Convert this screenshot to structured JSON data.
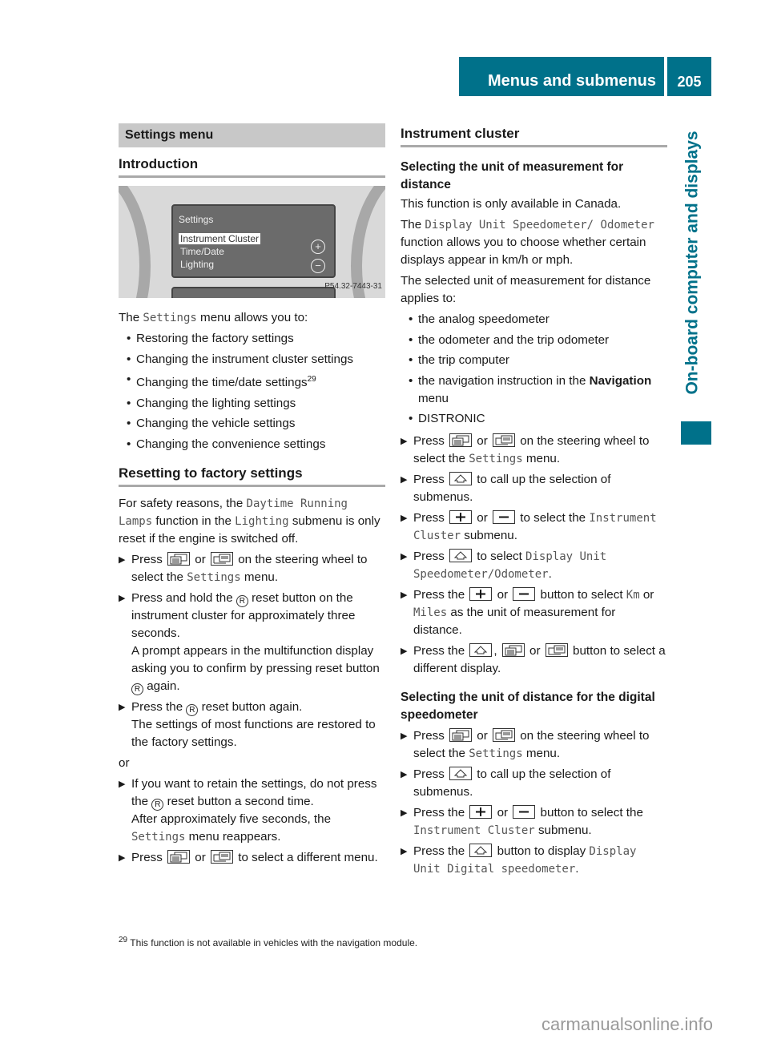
{
  "header": {
    "title": "Menus and submenus",
    "page_number": "205"
  },
  "side_tab": {
    "label": "On-board computer and displays"
  },
  "colors": {
    "accent": "#00718a",
    "section_bar": "#c8c8c8"
  },
  "left": {
    "section_title": "Settings menu",
    "intro_heading": "Introduction",
    "figure": {
      "screen_title": "Settings",
      "items": [
        "Instrument Cluster",
        "Time/Date",
        "Lighting"
      ],
      "selected_item": "Instrument Cluster",
      "plus_symbol": "+",
      "minus_symbol": "−",
      "code": "P54.32-7443-31"
    },
    "intro_text": [
      {
        "t": "The "
      },
      {
        "t": "Settings",
        "mono": true
      },
      {
        "t": " menu allows you to:"
      }
    ],
    "intro_bullets": [
      [
        {
          "t": "Restoring the factory settings"
        }
      ],
      [
        {
          "t": "Changing the instrument cluster settings"
        }
      ],
      [
        {
          "t": "Changing the time/date settings"
        },
        {
          "t": "29",
          "sup": true
        }
      ],
      [
        {
          "t": "Changing the lighting settings"
        }
      ],
      [
        {
          "t": "Changing the vehicle settings"
        }
      ],
      [
        {
          "t": "Changing the convenience settings"
        }
      ]
    ],
    "reset_heading": "Resetting to factory settings",
    "reset_text": [
      {
        "t": "For safety reasons, the "
      },
      {
        "t": "Daytime Running Lamps",
        "mono": true
      },
      {
        "t": " function in the "
      },
      {
        "t": "Lighting",
        "mono": true
      },
      {
        "t": " submenu is only reset if the engine is switched off."
      }
    ],
    "reset_steps": [
      {
        "type": "step",
        "parts": [
          {
            "t": "Press "
          },
          {
            "key": "menu-back"
          },
          {
            "t": " or "
          },
          {
            "key": "menu-fwd"
          },
          {
            "t": " on the steering wheel to select the "
          },
          {
            "t": "Settings",
            "mono": true
          },
          {
            "t": " menu."
          }
        ]
      },
      {
        "type": "step",
        "parts": [
          {
            "t": "Press and hold the "
          },
          {
            "key": "reset"
          },
          {
            "t": " reset button on the instrument cluster for approximately three seconds."
          },
          {
            "br": true
          },
          {
            "t": "A prompt appears in the multifunction display asking you to confirm by pressing reset button "
          },
          {
            "key": "reset"
          },
          {
            "t": " again."
          }
        ]
      },
      {
        "type": "step",
        "parts": [
          {
            "t": "Press the "
          },
          {
            "key": "reset"
          },
          {
            "t": " reset button again."
          },
          {
            "br": true
          },
          {
            "t": "The settings of most functions are restored to the factory settings."
          }
        ]
      },
      {
        "type": "plain",
        "parts": [
          {
            "t": "or"
          }
        ]
      },
      {
        "type": "step",
        "parts": [
          {
            "t": "If you want to retain the settings, do not press the "
          },
          {
            "key": "reset"
          },
          {
            "t": " reset button a second time."
          },
          {
            "br": true
          },
          {
            "t": "After approximately five seconds, the "
          },
          {
            "t": "Settings",
            "mono": true
          },
          {
            "t": " menu reappears."
          }
        ]
      },
      {
        "type": "step",
        "parts": [
          {
            "t": "Press "
          },
          {
            "key": "menu-back"
          },
          {
            "t": " or "
          },
          {
            "key": "menu-fwd"
          },
          {
            "t": " to select a different menu."
          }
        ]
      }
    ]
  },
  "right": {
    "section_heading": "Instrument cluster",
    "sub1_heading": "Selecting the unit of measurement for distance",
    "sub1_paras": [
      [
        {
          "t": "This function is only available in Canada."
        }
      ],
      [
        {
          "t": "The "
        },
        {
          "t": "Display Unit Speedometer/ Odometer",
          "mono": true
        },
        {
          "t": " function allows you to choose whether certain displays appear in km/h or mph."
        }
      ],
      [
        {
          "t": "The selected unit of measurement for distance applies to:"
        }
      ]
    ],
    "sub1_bullets": [
      [
        {
          "t": "the analog speedometer"
        }
      ],
      [
        {
          "t": "the odometer and the trip odometer"
        }
      ],
      [
        {
          "t": "the trip computer"
        }
      ],
      [
        {
          "t": "the navigation instruction in the "
        },
        {
          "t": "Navigation",
          "bold": true
        },
        {
          "t": " menu"
        }
      ],
      [
        {
          "t": "DISTRONIC"
        }
      ]
    ],
    "sub1_steps": [
      [
        {
          "t": "Press "
        },
        {
          "key": "menu-back"
        },
        {
          "t": " or "
        },
        {
          "key": "menu-fwd"
        },
        {
          "t": " on the steering wheel to select the "
        },
        {
          "t": "Settings",
          "mono": true
        },
        {
          "t": " menu."
        }
      ],
      [
        {
          "t": "Press "
        },
        {
          "key": "up"
        },
        {
          "t": " to call up the selection of submenus."
        }
      ],
      [
        {
          "t": "Press "
        },
        {
          "key": "plus"
        },
        {
          "t": " or "
        },
        {
          "key": "minus"
        },
        {
          "t": " to select the "
        },
        {
          "t": "Instrument Cluster",
          "mono": true
        },
        {
          "t": " submenu."
        }
      ],
      [
        {
          "t": "Press "
        },
        {
          "key": "up"
        },
        {
          "t": " to select "
        },
        {
          "t": "Display Unit Speedometer/Odometer",
          "mono": true
        },
        {
          "t": "."
        }
      ],
      [
        {
          "t": "Press the "
        },
        {
          "key": "plus"
        },
        {
          "t": " or "
        },
        {
          "key": "minus"
        },
        {
          "t": " button to select "
        },
        {
          "t": "Km",
          "mono": true
        },
        {
          "t": " or "
        },
        {
          "t": "Miles",
          "mono": true
        },
        {
          "t": " as the unit of measurement for distance."
        }
      ],
      [
        {
          "t": "Press the "
        },
        {
          "key": "up"
        },
        {
          "t": ", "
        },
        {
          "key": "menu-back"
        },
        {
          "t": " or "
        },
        {
          "key": "menu-fwd"
        },
        {
          "t": " button to select a different display."
        }
      ]
    ],
    "sub2_heading": "Selecting the unit of distance for the digital speedometer",
    "sub2_steps": [
      [
        {
          "t": "Press "
        },
        {
          "key": "menu-back"
        },
        {
          "t": " or "
        },
        {
          "key": "menu-fwd"
        },
        {
          "t": " on the steering wheel to select the "
        },
        {
          "t": "Settings",
          "mono": true
        },
        {
          "t": " menu."
        }
      ],
      [
        {
          "t": "Press "
        },
        {
          "key": "up"
        },
        {
          "t": " to call up the selection of submenus."
        }
      ],
      [
        {
          "t": "Press the "
        },
        {
          "key": "plus"
        },
        {
          "t": " or "
        },
        {
          "key": "minus"
        },
        {
          "t": " button to select the "
        },
        {
          "t": "Instrument Cluster",
          "mono": true
        },
        {
          "t": " submenu."
        }
      ],
      [
        {
          "t": "Press the "
        },
        {
          "key": "up"
        },
        {
          "t": " button to display "
        },
        {
          "t": "Display Unit Digital speedometer",
          "mono": true
        },
        {
          "t": "."
        }
      ]
    ]
  },
  "footnote": {
    "number": "29",
    "text": "This function is not available in vehicles with the navigation module."
  },
  "watermark": "carmanualsonline.info",
  "icons": {
    "menu-back": "menu-back-icon",
    "menu-fwd": "menu-forward-icon",
    "up": "up-arrow-icon",
    "plus": "plus-icon",
    "minus": "minus-icon",
    "reset": "reset-icon"
  }
}
